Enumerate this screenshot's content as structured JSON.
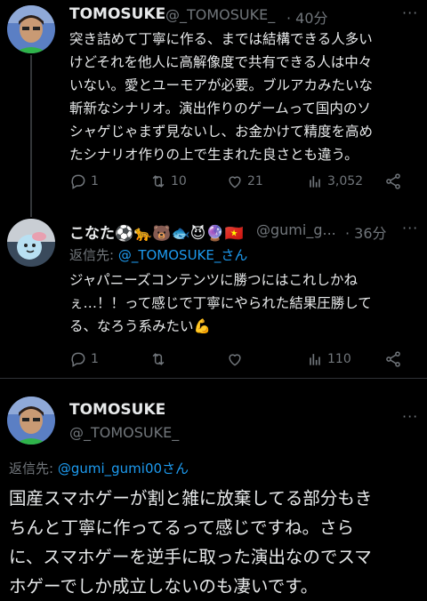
{
  "tweets": [
    {
      "name": "TOMOSUKE",
      "handle": "@_TOMOSUKE_",
      "time": "· 40分",
      "more": "···",
      "lines": [
        "突き詰めて丁寧に作る、までは結構できる人多い",
        "けどそれを他人に高解像度で共有できる人は中々",
        "いない。愛とユーモアが必要。ブルアカみたいな",
        "斬新なシナリオ。演出作りのゲームって国内のソ",
        "シャゲじゃまず見ないし、お金かけて精度を高め",
        "たシナリオ作りの上で生まれた良さとも違う。"
      ],
      "stats": {
        "replies": "1",
        "retweets": "10",
        "likes": "21",
        "views": "3,052"
      }
    },
    {
      "name": "こなた⚽🐆🐻🐟😈🔮🇻🇳",
      "handle": "@gumi_g...",
      "time": "· 36分",
      "more": "···",
      "reply_prefix": "返信先: ",
      "reply_target": "@_TOMOSUKE_さん",
      "lines": [
        "ジャパニーズコンテンツに勝つにはこれしかね",
        "ぇ…！！って感じで丁寧にやられた結果圧勝して",
        "る、なろう系みたい💪"
      ],
      "stats": {
        "replies": "1",
        "retweets": "",
        "likes": "",
        "views": "110"
      }
    },
    {
      "name": "TOMOSUKE",
      "handle": "@_TOMOSUKE_",
      "more": "···",
      "reply_prefix": "返信先: ",
      "reply_target": "@gumi_gumi00さん",
      "lines": [
        "国産スマホゲーが割と雑に放棄してる部分もき",
        "ちんと丁寧に作ってるって感じですね。さら",
        "に、スマホゲーを逆手に取った演出なのでスマ",
        "ホゲーでしか成立しないのも凄いです。"
      ]
    }
  ],
  "colors": {
    "background": "#000000",
    "text": "#e7e9ea",
    "muted": "#71767b",
    "link": "#1d9bf0",
    "divider": "#2f3336"
  },
  "icons": [
    "reply-icon",
    "retweet-icon",
    "like-icon",
    "views-icon",
    "share-icon",
    "more-icon"
  ]
}
